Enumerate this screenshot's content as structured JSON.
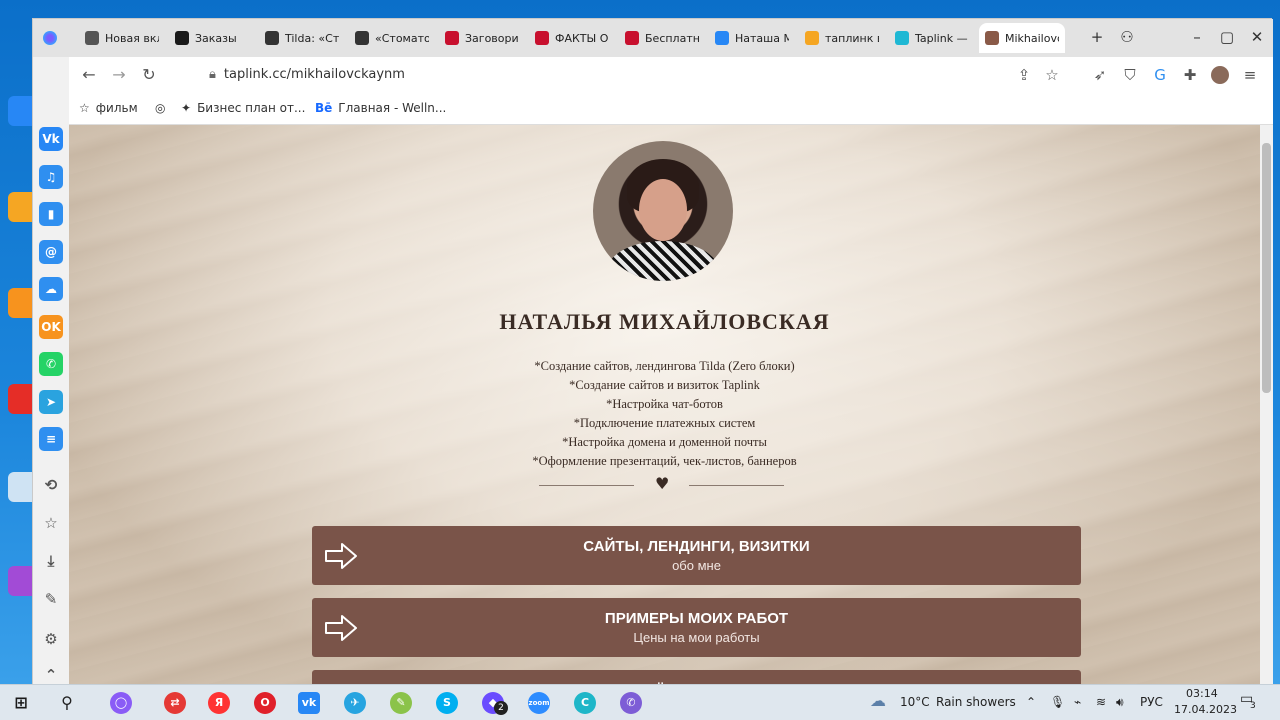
{
  "browser": {
    "tabs": [
      {
        "label": "Новая вкл",
        "icon": "home-icon",
        "color": "#555555"
      },
      {
        "label": "Заказы",
        "icon": "site-favicon",
        "color": "#1a1a1a"
      },
      {
        "label": "Tilda: «Сто",
        "icon": "tilda-icon",
        "color": "#333333"
      },
      {
        "label": "«Стоматол",
        "icon": "tilda-icon",
        "color": "#333333"
      },
      {
        "label": "Заговори",
        "icon": "uk-flag-icon",
        "color": "#c8102e"
      },
      {
        "label": "ФАКТЫ О",
        "icon": "uk-flag-icon",
        "color": "#c8102e"
      },
      {
        "label": "Бесплатн",
        "icon": "uk-flag-icon",
        "color": "#c8102e"
      },
      {
        "label": "Наташа М",
        "icon": "vk-icon",
        "color": "#2787f5"
      },
      {
        "label": "таплинк в",
        "icon": "mail-icon",
        "color": "#f5a623"
      },
      {
        "label": "Taplink —",
        "icon": "taplink-icon",
        "color": "#1fb8d4"
      },
      {
        "label": "Mikhailovc",
        "icon": "avatar-favicon",
        "color": "#8a5a48"
      }
    ],
    "new_tab": "+",
    "url": "taplink.cc/mikhailovckaynm",
    "bookmarks": [
      {
        "label": "фильм",
        "icon": "star-icon"
      },
      {
        "label": "",
        "icon": "globe-icon"
      },
      {
        "label": "Бизнес план от...",
        "icon": "bird-icon"
      },
      {
        "label": "Главная - Welln...",
        "icon": "behance-icon"
      }
    ]
  },
  "sidebar": {
    "items": [
      {
        "name": "vk",
        "glyph": "Vk",
        "color": "#2787f5"
      },
      {
        "name": "music",
        "glyph": "♫",
        "color": "#2f8ff0"
      },
      {
        "name": "stats",
        "glyph": "▮",
        "color": "#2f8ff0"
      },
      {
        "name": "mail",
        "glyph": "@",
        "color": "#2f8ff0"
      },
      {
        "name": "cloud",
        "glyph": "☁",
        "color": "#2f8ff0"
      },
      {
        "name": "ok",
        "glyph": "OK",
        "color": "#f7931e"
      },
      {
        "name": "whatsapp",
        "glyph": "✆",
        "color": "#25d366"
      },
      {
        "name": "telegram",
        "glyph": "➤",
        "color": "#2aa3df"
      },
      {
        "name": "list",
        "glyph": "≡",
        "color": "#2f8ff0"
      }
    ]
  },
  "page": {
    "name": "НАТАЛЬЯ МИХАЙЛОВСКАЯ",
    "description": [
      "*Создание сайтов, лендингова Tilda (Zero блоки)",
      "*Создание сайтов и визиток Taplink",
      "*Настройка чат-ботов",
      "*Подключение платежных систем",
      "*Настройка домена и доменной почты",
      "*Оформление презентаций, чек-листов, баннеров"
    ],
    "heart": "♥",
    "buttons": [
      {
        "title": "САЙТЫ, ЛЕНДИНГИ, ВИЗИТКИ",
        "subtitle": "обо мне"
      },
      {
        "title": "ПРИМЕРЫ МОИХ РАБОТ",
        "subtitle": "Цены на мои работы"
      },
      {
        "title": "МОЁ УВЛЕЧЕНИЕ",
        "subtitle": ""
      }
    ],
    "button_color": "#7a5449"
  },
  "taskbar": {
    "weather_temp": "10°C",
    "weather_text": "Rain showers",
    "lang": "РУС",
    "time": "03:14",
    "date": "17.04.2023",
    "notification_count": "3",
    "badge_count": "2"
  }
}
